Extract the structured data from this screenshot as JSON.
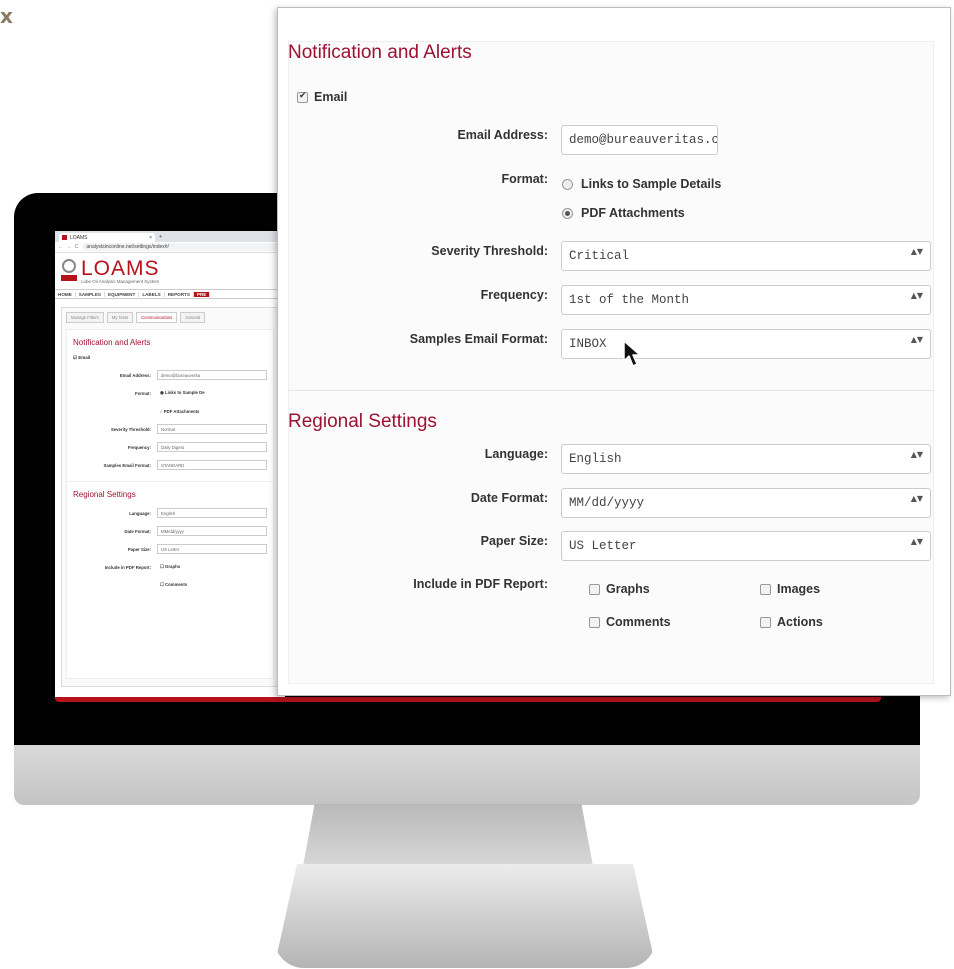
{
  "corner_glyph": "x",
  "background_app": {
    "tab_title": "LOAMS",
    "tab_close": "×",
    "new_tab": "+",
    "nav_glyphs": "← → C",
    "url": "analystsinconline.net/settings/index#/",
    "logo_text": "LOAMS",
    "logo_subtitle": "Lube Oil Analysis Management System",
    "nav": [
      "HOME",
      "SAMPLES",
      "EQUIPMENT",
      "LABELS",
      "REPORTS",
      "PRE"
    ],
    "subtabs": [
      "Manage Filters",
      "My Tests",
      "Communications",
      "General"
    ],
    "notifications_title": "Notification and Alerts",
    "email_label": "Email",
    "rows": [
      {
        "label": "Email Address:",
        "value": "demo@bureauverita"
      },
      {
        "label": "Format:",
        "value": "Links to Sample De"
      },
      {
        "label": "",
        "value": "PDF Attachments"
      },
      {
        "label": "Severity Threshold:",
        "value": "Normal"
      },
      {
        "label": "Frequency:",
        "value": "Daily Digest"
      },
      {
        "label": "Samples Email Format:",
        "value": "STANDARD"
      }
    ],
    "regional_title": "Regional Settings",
    "regional_rows": [
      {
        "label": "Language:",
        "value": "English"
      },
      {
        "label": "Date Format:",
        "value": "MM/dd/yyyy"
      },
      {
        "label": "Paper Size:",
        "value": "US Letter"
      },
      {
        "label": "Include in PDF Report:",
        "value": "Graphs"
      },
      {
        "label": "",
        "value": "Comments"
      }
    ]
  },
  "notifications": {
    "title": "Notification and Alerts",
    "email_checkbox_label": "Email",
    "email_checked": true,
    "email_address_label": "Email Address:",
    "email_address_value": "demo@bureauveritas.cor",
    "format_label": "Format:",
    "format_options": [
      "Links to Sample Details",
      "PDF Attachments"
    ],
    "format_selected": "PDF Attachments",
    "severity_label": "Severity Threshold:",
    "severity_value": "Critical",
    "frequency_label": "Frequency:",
    "frequency_value": "1st of the Month",
    "samples_format_label": "Samples Email Format:",
    "samples_format_value": "INBOX"
  },
  "regional": {
    "title": "Regional Settings",
    "language_label": "Language:",
    "language_value": "English",
    "date_format_label": "Date Format:",
    "date_format_value": "MM/dd/yyyy",
    "paper_size_label": "Paper Size:",
    "paper_size_value": "US Letter",
    "include_label": "Include in PDF Report:",
    "include_options": [
      "Graphs",
      "Images",
      "Comments",
      "Actions"
    ]
  },
  "select_arrows": "▲▼",
  "colors": {
    "accent": "#9d1233",
    "brand_red": "#b5121b"
  }
}
